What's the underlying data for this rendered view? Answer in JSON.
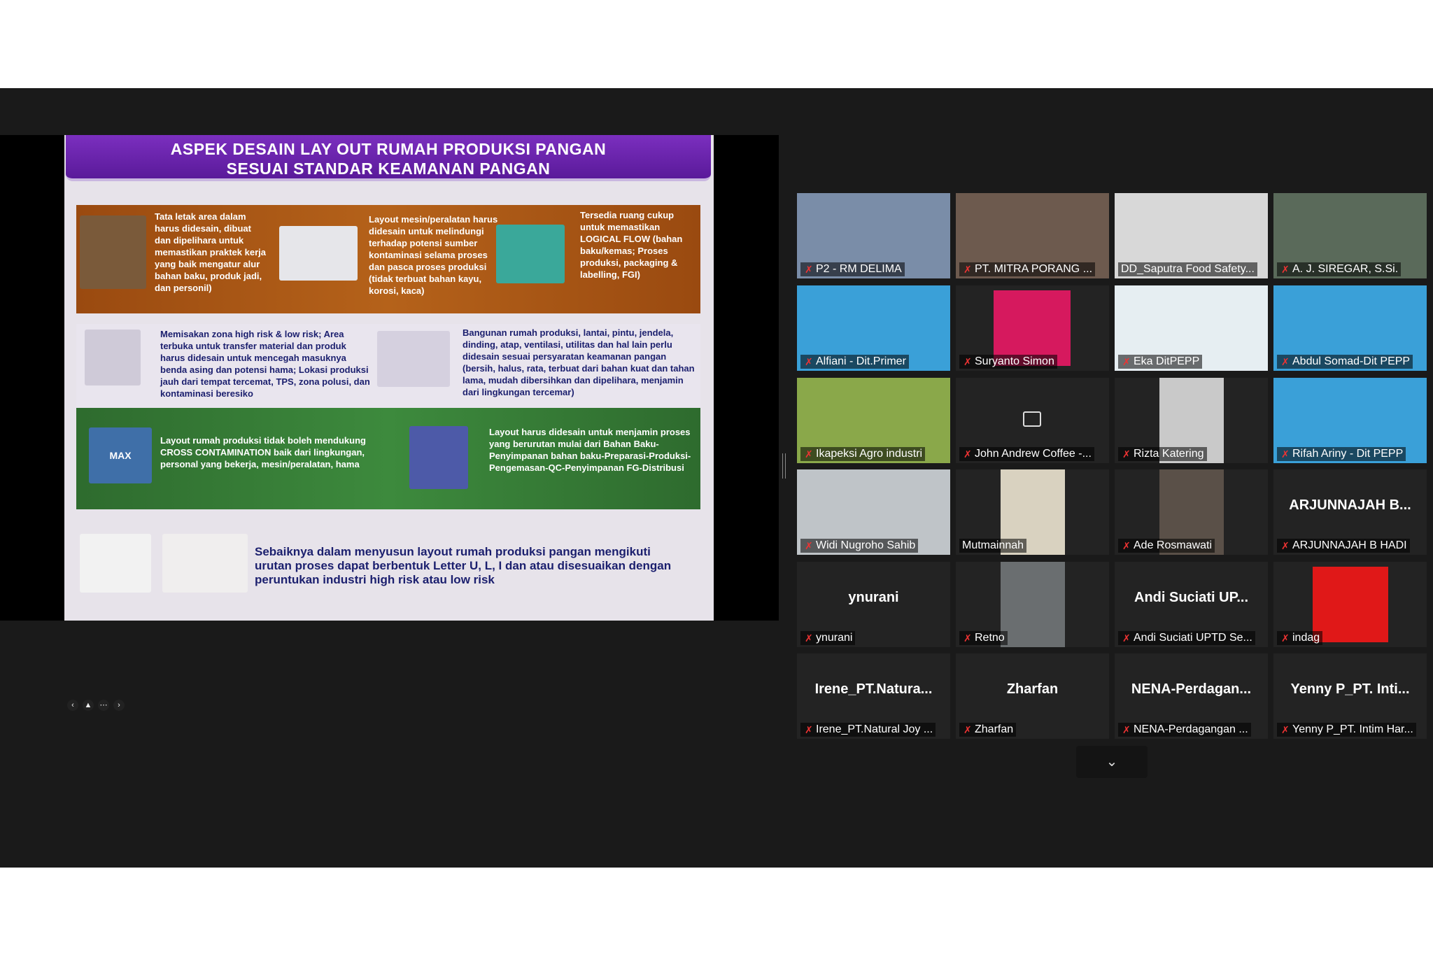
{
  "slide": {
    "title_line1": "ASPEK DESAIN LAY OUT RUMAH PRODUKSI PANGAN",
    "title_line2": "SESUAI STANDAR KEAMANAN PANGAN",
    "orange_1": "Tata letak area dalam harus didesain, dibuat dan dipelihara untuk memastikan praktek kerja yang baik mengatur alur bahan baku, produk jadi, dan personil)",
    "orange_2": "Layout mesin/peralatan harus didesain untuk melindungi terhadap potensi sumber kontaminasi selama proses dan pasca proses produksi (tidak terbuat bahan kayu, korosi, kaca)",
    "orange_3": "Tersedia ruang cukup untuk memastikan LOGICAL FLOW (bahan baku/kemas; Proses produksi, packaging & labelling, FGI)",
    "gray_1": "Memisakan zona high risk & low risk; Area terbuka untuk transfer material dan produk harus didesain untuk mencegah masuknya benda asing dan potensi hama; Lokasi produksi jauh dari tempat tercemat, TPS, zona polusi, dan kontaminasi beresiko",
    "gray_2": "Bangunan rumah produksi, lantai, pintu, jendela, dinding, atap, ventilasi, utilitas dan hal lain perlu didesain sesuai persyaratan keamanan pangan (bersih, halus, rata, terbuat dari bahan kuat dan tahan lama, mudah dibersihkan dan dipelihara, menjamin dari lingkungan tercemar)",
    "green_1": "Layout rumah produksi tidak boleh mendukung CROSS CONTAMINATION baik dari lingkungan, personal yang bekerja, mesin/peralatan, hama",
    "green_2": "Layout harus didesain untuk menjamin proses yang berurutan mulai dari Bahan Baku-Penyimpanan bahan baku-Preparasi-Produksi-Pengemasan-QC-Penyimpanan FG-Distribusi",
    "bottom": "Sebaiknya dalam menyusun layout rumah produksi pangan mengikuti urutan proses dapat berbentuk Letter U, L, I dan atau disesuaikan dengan peruntukan industri high risk atau low risk",
    "max_label": "MAX"
  },
  "participants": [
    {
      "name": "P2 - RM DELIMA",
      "big": "",
      "kind": "video",
      "color": "#7a8da8",
      "muted": true
    },
    {
      "name": "PT. MITRA PORANG ...",
      "big": "",
      "kind": "video",
      "color": "#6d5a4e",
      "muted": true
    },
    {
      "name": "DD_Saputra Food Safety...",
      "big": "",
      "kind": "video",
      "color": "#d8d8d8",
      "muted": false,
      "active": true
    },
    {
      "name": "A. J. SIREGAR, S.Si.",
      "big": "",
      "kind": "video",
      "color": "#5a6a5a",
      "muted": true
    },
    {
      "name": "Alfiani - Dit.Primer",
      "big": "",
      "kind": "webinar",
      "color": "#3aa0d8",
      "muted": true
    },
    {
      "name": "Suryanto Simon",
      "big": "",
      "kind": "avatar",
      "color": "#d6195e",
      "muted": true
    },
    {
      "name": "Eka DitPEPP",
      "big": "",
      "kind": "webinar2",
      "color": "#e6eef2",
      "muted": true
    },
    {
      "name": "Abdul Somad-Dit PEPP",
      "big": "",
      "kind": "webinar",
      "color": "#3aa0d8",
      "muted": true
    },
    {
      "name": "Ikapeksi Agro industri",
      "big": "",
      "kind": "video",
      "color": "#8aa84a",
      "muted": true
    },
    {
      "name": "John Andrew Coffee -...",
      "big": "",
      "kind": "videooff",
      "color": "#232323",
      "muted": true
    },
    {
      "name": "Rizta Katering",
      "big": "",
      "kind": "video-narrow",
      "color": "#c9c9c9",
      "muted": true
    },
    {
      "name": "Rifah Ariny - Dit PEPP",
      "big": "",
      "kind": "webinar",
      "color": "#3aa0d8",
      "muted": true
    },
    {
      "name": "Widi Nugroho Sahib",
      "big": "",
      "kind": "video",
      "color": "#bfc4c8",
      "muted": true
    },
    {
      "name": "Mutmainnah",
      "big": "",
      "kind": "video-narrow",
      "color": "#d9d2c0",
      "muted": false
    },
    {
      "name": "Ade Rosmawati",
      "big": "",
      "kind": "video-narrow",
      "color": "#5a5048",
      "muted": true
    },
    {
      "name": "ARJUNNAJAH B HADI",
      "big": "ARJUNNAJAH B...",
      "kind": "name",
      "color": "#232323",
      "muted": true
    },
    {
      "name": "ynurani",
      "big": "ynurani",
      "kind": "name",
      "color": "#232323",
      "muted": true
    },
    {
      "name": "Retno",
      "big": "",
      "kind": "video-narrow",
      "color": "#6a6e70",
      "muted": true
    },
    {
      "name": "Andi Suciati UPTD Se...",
      "big": "Andi Suciati UP...",
      "kind": "name",
      "color": "#232323",
      "muted": true
    },
    {
      "name": "indag",
      "big": "",
      "kind": "photo",
      "color": "#e01818",
      "muted": true
    },
    {
      "name": "Irene_PT.Natural Joy ...",
      "big": "Irene_PT.Natura...",
      "kind": "name",
      "color": "#232323",
      "muted": true
    },
    {
      "name": "Zharfan",
      "big": "Zharfan",
      "kind": "name",
      "color": "#232323",
      "muted": true
    },
    {
      "name": "NENA-Perdagangan ...",
      "big": "NENA-Perdagan...",
      "kind": "name",
      "color": "#232323",
      "muted": true
    },
    {
      "name": "Yenny P_PT. Intim Har...",
      "big": "Yenny P_PT. Inti...",
      "kind": "name",
      "color": "#232323",
      "muted": true
    }
  ],
  "icons": {
    "muted_mic": "mic-off-icon",
    "next_page": "chevron-down-icon",
    "video_off": "video-off-icon"
  }
}
